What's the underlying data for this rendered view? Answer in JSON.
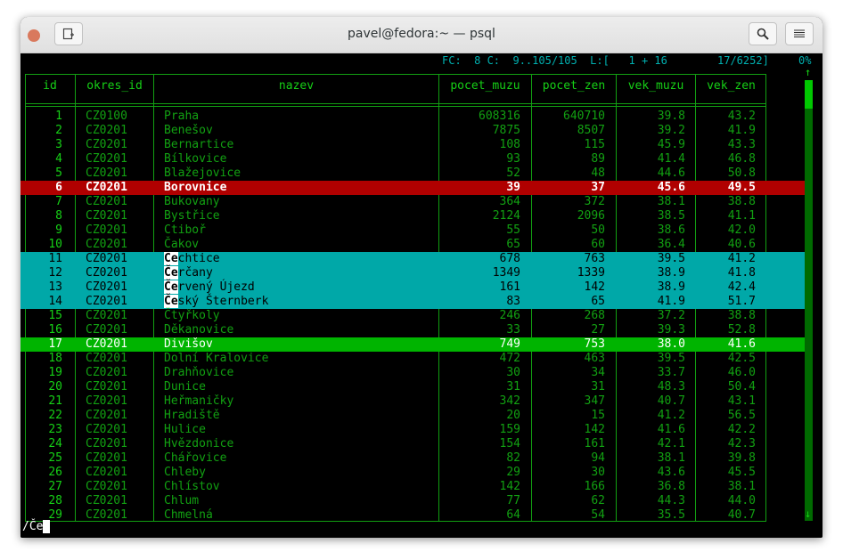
{
  "window": {
    "title": "pavel@fedora:~ — psql",
    "new_tab_icon": "new-tab-icon",
    "search_icon": "search-icon",
    "menu_icon": "menu-icon"
  },
  "status": {
    "fc": "FC:  8 C:  9..105/105  L:[   1 + 16",
    "position": "17/6252]",
    "percent": "0%"
  },
  "table": {
    "columns": [
      "id",
      "okres_id",
      "nazev",
      "pocet_muzu",
      "pocet_zen",
      "vek_muzu",
      "vek_zen"
    ],
    "rows": [
      {
        "id": "1",
        "okres_id": "CZ0100",
        "nazev": "Praha",
        "pocet_muzu": "608316",
        "pocet_zen": "640710",
        "vek_muzu": "39.8",
        "vek_zen": "43.2",
        "hl": ""
      },
      {
        "id": "2",
        "okres_id": "CZ0201",
        "nazev": "Benešov",
        "pocet_muzu": "7875",
        "pocet_zen": "8507",
        "vek_muzu": "39.2",
        "vek_zen": "41.9",
        "hl": ""
      },
      {
        "id": "3",
        "okres_id": "CZ0201",
        "nazev": "Bernartice",
        "pocet_muzu": "108",
        "pocet_zen": "115",
        "vek_muzu": "45.9",
        "vek_zen": "43.3",
        "hl": ""
      },
      {
        "id": "4",
        "okres_id": "CZ0201",
        "nazev": "Bílkovice",
        "pocet_muzu": "93",
        "pocet_zen": "89",
        "vek_muzu": "41.4",
        "vek_zen": "46.8",
        "hl": ""
      },
      {
        "id": "5",
        "okres_id": "CZ0201",
        "nazev": "Blažejovice",
        "pocet_muzu": "52",
        "pocet_zen": "48",
        "vek_muzu": "44.6",
        "vek_zen": "50.8",
        "hl": ""
      },
      {
        "id": "6",
        "okres_id": "CZ0201",
        "nazev": "Borovnice",
        "pocet_muzu": "39",
        "pocet_zen": "37",
        "vek_muzu": "45.6",
        "vek_zen": "49.5",
        "hl": "red"
      },
      {
        "id": "7",
        "okres_id": "CZ0201",
        "nazev": "Bukovany",
        "pocet_muzu": "364",
        "pocet_zen": "372",
        "vek_muzu": "38.1",
        "vek_zen": "38.8",
        "hl": ""
      },
      {
        "id": "8",
        "okres_id": "CZ0201",
        "nazev": "Bystřice",
        "pocet_muzu": "2124",
        "pocet_zen": "2096",
        "vek_muzu": "38.5",
        "vek_zen": "41.1",
        "hl": ""
      },
      {
        "id": "9",
        "okres_id": "CZ0201",
        "nazev": "Ctiboř",
        "pocet_muzu": "55",
        "pocet_zen": "50",
        "vek_muzu": "38.6",
        "vek_zen": "42.0",
        "hl": ""
      },
      {
        "id": "10",
        "okres_id": "CZ0201",
        "nazev": "Čakov",
        "pocet_muzu": "65",
        "pocet_zen": "60",
        "vek_muzu": "36.4",
        "vek_zen": "40.6",
        "hl": ""
      },
      {
        "id": "11",
        "okres_id": "CZ0201",
        "nazev": "Čechtice",
        "pocet_muzu": "678",
        "pocet_zen": "763",
        "vek_muzu": "39.5",
        "vek_zen": "41.2",
        "hl": "cyan"
      },
      {
        "id": "12",
        "okres_id": "CZ0201",
        "nazev": "Čerčany",
        "pocet_muzu": "1349",
        "pocet_zen": "1339",
        "vek_muzu": "38.9",
        "vek_zen": "41.8",
        "hl": "cyan"
      },
      {
        "id": "13",
        "okres_id": "CZ0201",
        "nazev": "Červený Újezd",
        "pocet_muzu": "161",
        "pocet_zen": "142",
        "vek_muzu": "38.9",
        "vek_zen": "42.4",
        "hl": "cyan"
      },
      {
        "id": "14",
        "okres_id": "CZ0201",
        "nazev": "Český Šternberk",
        "pocet_muzu": "83",
        "pocet_zen": "65",
        "vek_muzu": "41.9",
        "vek_zen": "51.7",
        "hl": "cyan"
      },
      {
        "id": "15",
        "okres_id": "CZ0201",
        "nazev": "Čtyřkoly",
        "pocet_muzu": "246",
        "pocet_zen": "268",
        "vek_muzu": "37.2",
        "vek_zen": "38.8",
        "hl": ""
      },
      {
        "id": "16",
        "okres_id": "CZ0201",
        "nazev": "Děkanovice",
        "pocet_muzu": "33",
        "pocet_zen": "27",
        "vek_muzu": "39.3",
        "vek_zen": "52.8",
        "hl": ""
      },
      {
        "id": "17",
        "okres_id": "CZ0201",
        "nazev": "Divišov",
        "pocet_muzu": "749",
        "pocet_zen": "753",
        "vek_muzu": "38.0",
        "vek_zen": "41.6",
        "hl": "green"
      },
      {
        "id": "18",
        "okres_id": "CZ0201",
        "nazev": "Dolní Kralovice",
        "pocet_muzu": "472",
        "pocet_zen": "463",
        "vek_muzu": "39.5",
        "vek_zen": "42.5",
        "hl": ""
      },
      {
        "id": "19",
        "okres_id": "CZ0201",
        "nazev": "Drahňovice",
        "pocet_muzu": "30",
        "pocet_zen": "34",
        "vek_muzu": "33.7",
        "vek_zen": "46.0",
        "hl": ""
      },
      {
        "id": "20",
        "okres_id": "CZ0201",
        "nazev": "Dunice",
        "pocet_muzu": "31",
        "pocet_zen": "31",
        "vek_muzu": "48.3",
        "vek_zen": "50.4",
        "hl": ""
      },
      {
        "id": "21",
        "okres_id": "CZ0201",
        "nazev": "Heřmaničky",
        "pocet_muzu": "342",
        "pocet_zen": "347",
        "vek_muzu": "40.7",
        "vek_zen": "43.1",
        "hl": ""
      },
      {
        "id": "22",
        "okres_id": "CZ0201",
        "nazev": "Hradiště",
        "pocet_muzu": "20",
        "pocet_zen": "15",
        "vek_muzu": "41.2",
        "vek_zen": "56.5",
        "hl": ""
      },
      {
        "id": "23",
        "okres_id": "CZ0201",
        "nazev": "Hulice",
        "pocet_muzu": "159",
        "pocet_zen": "142",
        "vek_muzu": "41.6",
        "vek_zen": "42.2",
        "hl": ""
      },
      {
        "id": "24",
        "okres_id": "CZ0201",
        "nazev": "Hvězdonice",
        "pocet_muzu": "154",
        "pocet_zen": "161",
        "vek_muzu": "42.1",
        "vek_zen": "42.3",
        "hl": ""
      },
      {
        "id": "25",
        "okres_id": "CZ0201",
        "nazev": "Chářovice",
        "pocet_muzu": "82",
        "pocet_zen": "94",
        "vek_muzu": "38.1",
        "vek_zen": "39.8",
        "hl": ""
      },
      {
        "id": "26",
        "okres_id": "CZ0201",
        "nazev": "Chleby",
        "pocet_muzu": "29",
        "pocet_zen": "30",
        "vek_muzu": "43.6",
        "vek_zen": "45.5",
        "hl": ""
      },
      {
        "id": "27",
        "okres_id": "CZ0201",
        "nazev": "Chlístov",
        "pocet_muzu": "142",
        "pocet_zen": "166",
        "vek_muzu": "36.8",
        "vek_zen": "38.1",
        "hl": ""
      },
      {
        "id": "28",
        "okres_id": "CZ0201",
        "nazev": "Chlum",
        "pocet_muzu": "77",
        "pocet_zen": "62",
        "vek_muzu": "44.3",
        "vek_zen": "44.0",
        "hl": ""
      },
      {
        "id": "29",
        "okres_id": "CZ0201",
        "nazev": "Chmelná",
        "pocet_muzu": "64",
        "pocet_zen": "54",
        "vek_muzu": "35.5",
        "vek_zen": "40.7",
        "hl": ""
      }
    ]
  },
  "search": {
    "query": "/Če",
    "match": "Če"
  },
  "scrollbar": {
    "up_arrow": "↑",
    "down_arrow": "↓"
  },
  "colors": {
    "grid": "#12a012",
    "text": "#12a012",
    "cursor_row": "#b00000",
    "match_rows": "#00a8a8",
    "mark_row": "#00b400",
    "status": "#00b0b0"
  }
}
